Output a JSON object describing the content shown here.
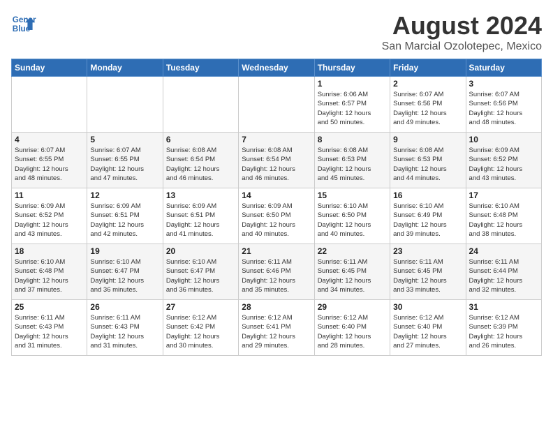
{
  "header": {
    "logo_line1": "General",
    "logo_line2": "Blue",
    "month": "August 2024",
    "location": "San Marcial Ozolotepec, Mexico"
  },
  "weekdays": [
    "Sunday",
    "Monday",
    "Tuesday",
    "Wednesday",
    "Thursday",
    "Friday",
    "Saturday"
  ],
  "weeks": [
    [
      {
        "day": "",
        "info": ""
      },
      {
        "day": "",
        "info": ""
      },
      {
        "day": "",
        "info": ""
      },
      {
        "day": "",
        "info": ""
      },
      {
        "day": "1",
        "info": "Sunrise: 6:06 AM\nSunset: 6:57 PM\nDaylight: 12 hours\nand 50 minutes."
      },
      {
        "day": "2",
        "info": "Sunrise: 6:07 AM\nSunset: 6:56 PM\nDaylight: 12 hours\nand 49 minutes."
      },
      {
        "day": "3",
        "info": "Sunrise: 6:07 AM\nSunset: 6:56 PM\nDaylight: 12 hours\nand 48 minutes."
      }
    ],
    [
      {
        "day": "4",
        "info": "Sunrise: 6:07 AM\nSunset: 6:55 PM\nDaylight: 12 hours\nand 48 minutes."
      },
      {
        "day": "5",
        "info": "Sunrise: 6:07 AM\nSunset: 6:55 PM\nDaylight: 12 hours\nand 47 minutes."
      },
      {
        "day": "6",
        "info": "Sunrise: 6:08 AM\nSunset: 6:54 PM\nDaylight: 12 hours\nand 46 minutes."
      },
      {
        "day": "7",
        "info": "Sunrise: 6:08 AM\nSunset: 6:54 PM\nDaylight: 12 hours\nand 46 minutes."
      },
      {
        "day": "8",
        "info": "Sunrise: 6:08 AM\nSunset: 6:53 PM\nDaylight: 12 hours\nand 45 minutes."
      },
      {
        "day": "9",
        "info": "Sunrise: 6:08 AM\nSunset: 6:53 PM\nDaylight: 12 hours\nand 44 minutes."
      },
      {
        "day": "10",
        "info": "Sunrise: 6:09 AM\nSunset: 6:52 PM\nDaylight: 12 hours\nand 43 minutes."
      }
    ],
    [
      {
        "day": "11",
        "info": "Sunrise: 6:09 AM\nSunset: 6:52 PM\nDaylight: 12 hours\nand 43 minutes."
      },
      {
        "day": "12",
        "info": "Sunrise: 6:09 AM\nSunset: 6:51 PM\nDaylight: 12 hours\nand 42 minutes."
      },
      {
        "day": "13",
        "info": "Sunrise: 6:09 AM\nSunset: 6:51 PM\nDaylight: 12 hours\nand 41 minutes."
      },
      {
        "day": "14",
        "info": "Sunrise: 6:09 AM\nSunset: 6:50 PM\nDaylight: 12 hours\nand 40 minutes."
      },
      {
        "day": "15",
        "info": "Sunrise: 6:10 AM\nSunset: 6:50 PM\nDaylight: 12 hours\nand 40 minutes."
      },
      {
        "day": "16",
        "info": "Sunrise: 6:10 AM\nSunset: 6:49 PM\nDaylight: 12 hours\nand 39 minutes."
      },
      {
        "day": "17",
        "info": "Sunrise: 6:10 AM\nSunset: 6:48 PM\nDaylight: 12 hours\nand 38 minutes."
      }
    ],
    [
      {
        "day": "18",
        "info": "Sunrise: 6:10 AM\nSunset: 6:48 PM\nDaylight: 12 hours\nand 37 minutes."
      },
      {
        "day": "19",
        "info": "Sunrise: 6:10 AM\nSunset: 6:47 PM\nDaylight: 12 hours\nand 36 minutes."
      },
      {
        "day": "20",
        "info": "Sunrise: 6:10 AM\nSunset: 6:47 PM\nDaylight: 12 hours\nand 36 minutes."
      },
      {
        "day": "21",
        "info": "Sunrise: 6:11 AM\nSunset: 6:46 PM\nDaylight: 12 hours\nand 35 minutes."
      },
      {
        "day": "22",
        "info": "Sunrise: 6:11 AM\nSunset: 6:45 PM\nDaylight: 12 hours\nand 34 minutes."
      },
      {
        "day": "23",
        "info": "Sunrise: 6:11 AM\nSunset: 6:45 PM\nDaylight: 12 hours\nand 33 minutes."
      },
      {
        "day": "24",
        "info": "Sunrise: 6:11 AM\nSunset: 6:44 PM\nDaylight: 12 hours\nand 32 minutes."
      }
    ],
    [
      {
        "day": "25",
        "info": "Sunrise: 6:11 AM\nSunset: 6:43 PM\nDaylight: 12 hours\nand 31 minutes."
      },
      {
        "day": "26",
        "info": "Sunrise: 6:11 AM\nSunset: 6:43 PM\nDaylight: 12 hours\nand 31 minutes."
      },
      {
        "day": "27",
        "info": "Sunrise: 6:12 AM\nSunset: 6:42 PM\nDaylight: 12 hours\nand 30 minutes."
      },
      {
        "day": "28",
        "info": "Sunrise: 6:12 AM\nSunset: 6:41 PM\nDaylight: 12 hours\nand 29 minutes."
      },
      {
        "day": "29",
        "info": "Sunrise: 6:12 AM\nSunset: 6:40 PM\nDaylight: 12 hours\nand 28 minutes."
      },
      {
        "day": "30",
        "info": "Sunrise: 6:12 AM\nSunset: 6:40 PM\nDaylight: 12 hours\nand 27 minutes."
      },
      {
        "day": "31",
        "info": "Sunrise: 6:12 AM\nSunset: 6:39 PM\nDaylight: 12 hours\nand 26 minutes."
      }
    ]
  ]
}
